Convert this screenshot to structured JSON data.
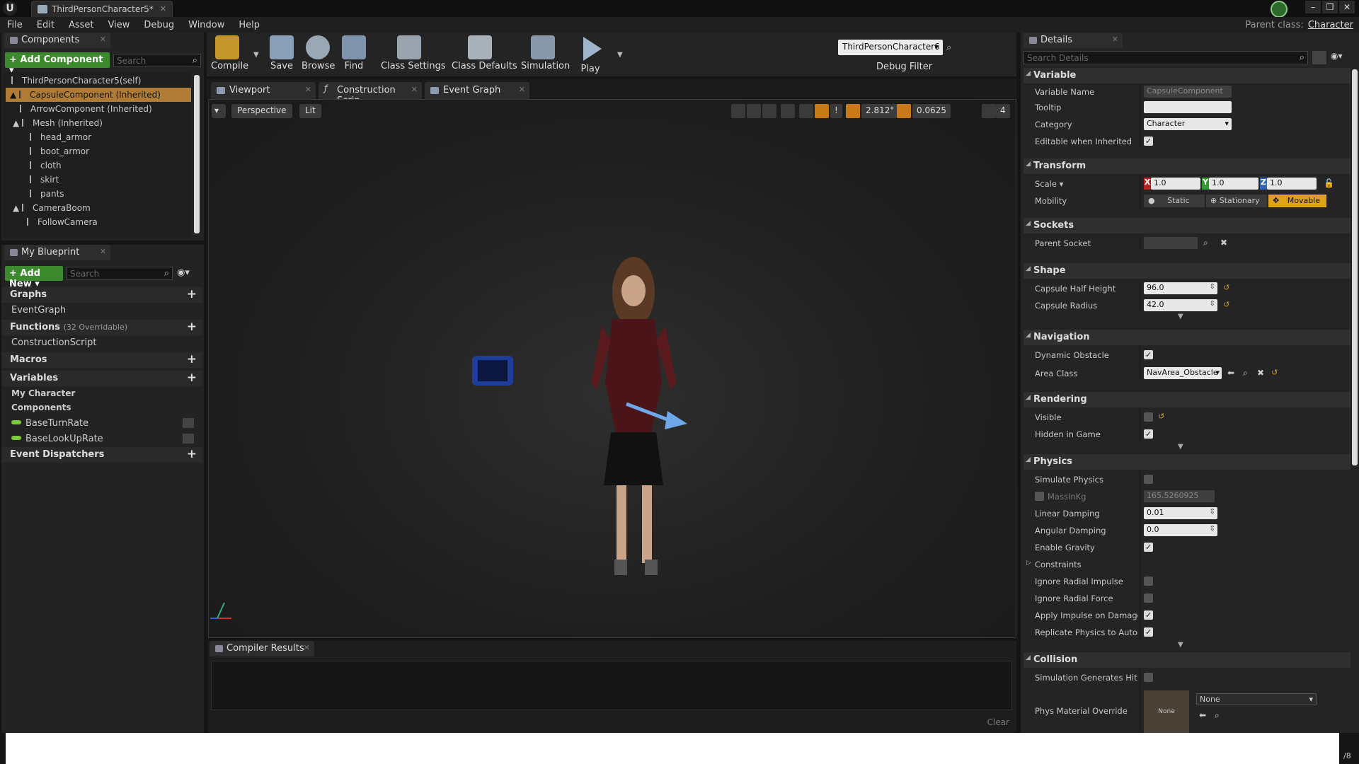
{
  "window": {
    "tab_title": "ThirdPersonCharacter5*",
    "parent_class_label": "Parent class:",
    "parent_class_value": "Character"
  },
  "menu": [
    "File",
    "Edit",
    "Asset",
    "View",
    "Debug",
    "Window",
    "Help"
  ],
  "components_panel": {
    "title": "Components",
    "add_button": "+ Add Component",
    "search_placeholder": "Search",
    "tree": [
      {
        "label": "ThirdPersonCharacter5(self)"
      },
      {
        "label": "CapsuleComponent (Inherited)",
        "selected": true
      },
      {
        "label": "ArrowComponent (Inherited)"
      },
      {
        "label": "Mesh (Inherited)"
      },
      {
        "label": "head_armor"
      },
      {
        "label": "boot_armor"
      },
      {
        "label": "cloth"
      },
      {
        "label": "skirt"
      },
      {
        "label": "pants"
      },
      {
        "label": "CameraBoom"
      },
      {
        "label": "FollowCamera"
      }
    ]
  },
  "my_blueprint": {
    "title": "My Blueprint",
    "add_button": "+ Add New",
    "search_placeholder": "Search",
    "graphs_label": "Graphs",
    "event_graph": "EventGraph",
    "functions_label": "Functions",
    "functions_count": "(32 Overridable)",
    "construction_script": "ConstructionScript",
    "macros_label": "Macros",
    "variables_label": "Variables",
    "my_character": "My Character",
    "components": "Components",
    "var1": "BaseTurnRate",
    "var2": "BaseLookUpRate",
    "dispatchers_label": "Event Dispatchers"
  },
  "toolbar": {
    "compile": "Compile",
    "save": "Save",
    "browse": "Browse",
    "find": "Find",
    "class_settings": "Class Settings",
    "class_defaults": "Class Defaults",
    "simulation": "Simulation",
    "play": "Play",
    "debug_combo": "ThirdPersonCharacter6",
    "debug_filter": "Debug Filter"
  },
  "editor_tabs": [
    "Viewport",
    "Construction Scrip",
    "Event Graph"
  ],
  "viewport": {
    "perspective": "Perspective",
    "lit": "Lit",
    "angle": "2.812°",
    "scale": "0.0625",
    "speed": "4",
    "warn": "!"
  },
  "compiler": {
    "title": "Compiler Results",
    "clear": "Clear"
  },
  "details": {
    "title": "Details",
    "search_placeholder": "Search Details",
    "sections": {
      "variable": "Variable",
      "transform": "Transform",
      "sockets": "Sockets",
      "shape": "Shape",
      "navigation": "Navigation",
      "rendering": "Rendering",
      "physics": "Physics",
      "collision": "Collision"
    },
    "variable_name_label": "Variable Name",
    "variable_name_value": "CapsuleComponent",
    "tooltip_label": "Tooltip",
    "category_label": "Category",
    "category_value": "Character",
    "editable_label": "Editable when Inherited",
    "scale_label": "Scale",
    "scale_x": "1.0",
    "scale_y": "1.0",
    "scale_z": "1.0",
    "mobility_label": "Mobility",
    "mobility_static": "Static",
    "mobility_stationary": "Stationary",
    "mobility_movable": "Movable",
    "parent_socket_label": "Parent Socket",
    "capsule_half_height_label": "Capsule Half Height",
    "capsule_half_height": "96.0",
    "capsule_radius_label": "Capsule Radius",
    "capsule_radius": "42.0",
    "dynamic_obstacle_label": "Dynamic Obstacle",
    "area_class_label": "Area Class",
    "area_class_value": "NavArea_Obstacle",
    "visible_label": "Visible",
    "hidden_label": "Hidden in Game",
    "simulate_physics_label": "Simulate Physics",
    "mass_label": "MassInKg",
    "mass_value": "165.5260925",
    "linear_damping_label": "Linear Damping",
    "linear_damping": "0.01",
    "angular_damping_label": "Angular Damping",
    "angular_damping": "0.0",
    "enable_gravity_label": "Enable Gravity",
    "constraints_label": "Constraints",
    "ignore_radial_impulse_label": "Ignore Radial Impulse",
    "ignore_radial_force_label": "Ignore Radial Force",
    "apply_impulse_label": "Apply Impulse on Damage",
    "replicate_label": "Replicate Physics to Autonon",
    "sim_hit_label": "Simulation Generates Hit Eve",
    "phys_material_label": "Phys Material Override",
    "phys_material_thumb": "None",
    "phys_material_value": "None"
  },
  "corner_text": "/8"
}
